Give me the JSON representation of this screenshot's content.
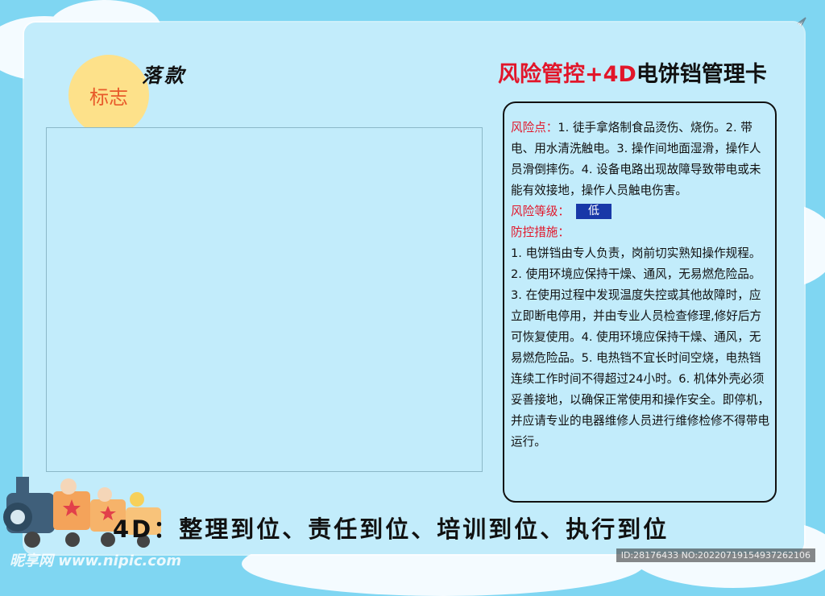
{
  "header": {
    "logo_label": "标志",
    "signature_label": "落款",
    "title_red": "风险管控+4D",
    "title_black": "电饼铛管理卡"
  },
  "info": {
    "risk_point_label": "风险点：",
    "risk_point_text": "1. 徒手拿烙制食品烫伤、烧伤。2. 带电、用水清洗触电。3. 操作间地面湿滑，操作人员滑倒摔伤。4. 设备电路出现故障导致带电或未能有效接地，操作人员触电伤害。",
    "risk_level_label": "风险等级：",
    "risk_level_value": "低",
    "risk_level_color": "#1838a8",
    "measures_label": "防控措施：",
    "measures_text": "1. 电饼铛由专人负责，岗前切实熟知操作规程。2. 使用环境应保持干燥、通风，无易燃危险品。3. 在使用过程中发现温度失控或其他故障时，应立即断电停用，并由专业人员检查修理,修好后方可恢复使用。4. 使用环境应保持干燥、通风，无易燃危险品。5. 电热铛不宜长时间空烧，电热铛连续工作时间不得超过24小时。6. 机体外壳必须妥善接地，以确保正常使用和操作安全。即停机，并应请专业的电器维修人员进行维修检修不得带电运行。"
  },
  "footer": {
    "slogan": "4D：整理到位、责任到位、培训到位、执行到位"
  },
  "watermark": {
    "site": "昵享网 www.nipic.com",
    "id": "ID:28176433 NO:20220719154937262106"
  },
  "colors": {
    "background": "#7fd6f2",
    "card": "#c2ecfb",
    "accent_red": "#e2162a",
    "logo_circle": "#fde18a"
  }
}
